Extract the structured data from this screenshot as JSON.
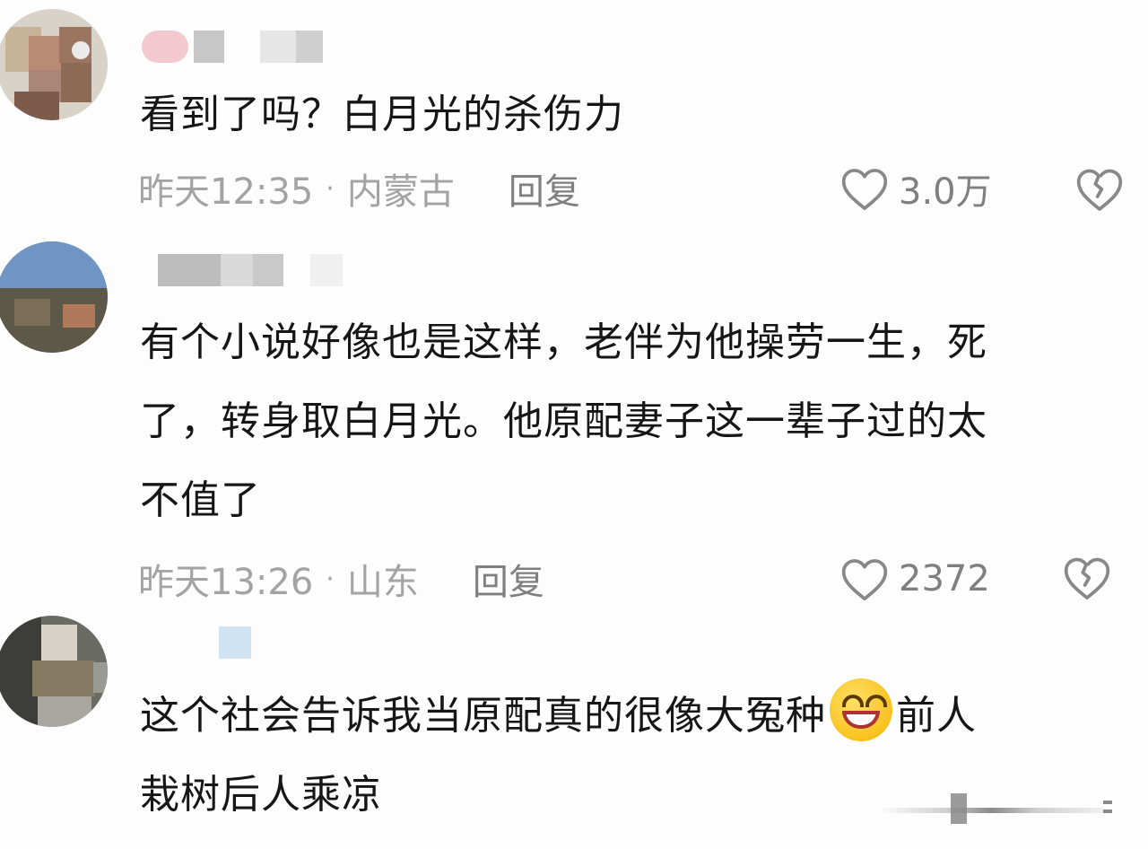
{
  "comments": [
    {
      "text": "看到了吗？白月光的杀伤力",
      "time": "昨天12:35",
      "location": "内蒙古",
      "reply_label": "回复",
      "likes": "3.0万",
      "icons": [
        "avatar",
        "heart-icon",
        "broken-heart-icon"
      ]
    },
    {
      "text_lines": [
        "有个小说好像也是这样，老伴为他操劳一生，死",
        "了，转身取白月光。他原配妻子这一辈子过的太",
        "不值了"
      ],
      "time": "昨天13:26",
      "location": "山东",
      "reply_label": "回复",
      "likes": "2372",
      "icons": [
        "avatar",
        "heart-icon",
        "broken-heart-icon"
      ]
    },
    {
      "text_before_emoji": "这个社会告诉我当原配真的很像大冤种",
      "emoji": "grinning-face-emoji",
      "text_after_emoji": "前人",
      "text_line2": "栽树后人乘凉",
      "icons": [
        "avatar"
      ]
    }
  ],
  "separator": "·",
  "colors": {
    "text": "#161616",
    "meta": "#a3a3a3",
    "action": "#7f7f7f",
    "background": "#fdfdfd"
  }
}
